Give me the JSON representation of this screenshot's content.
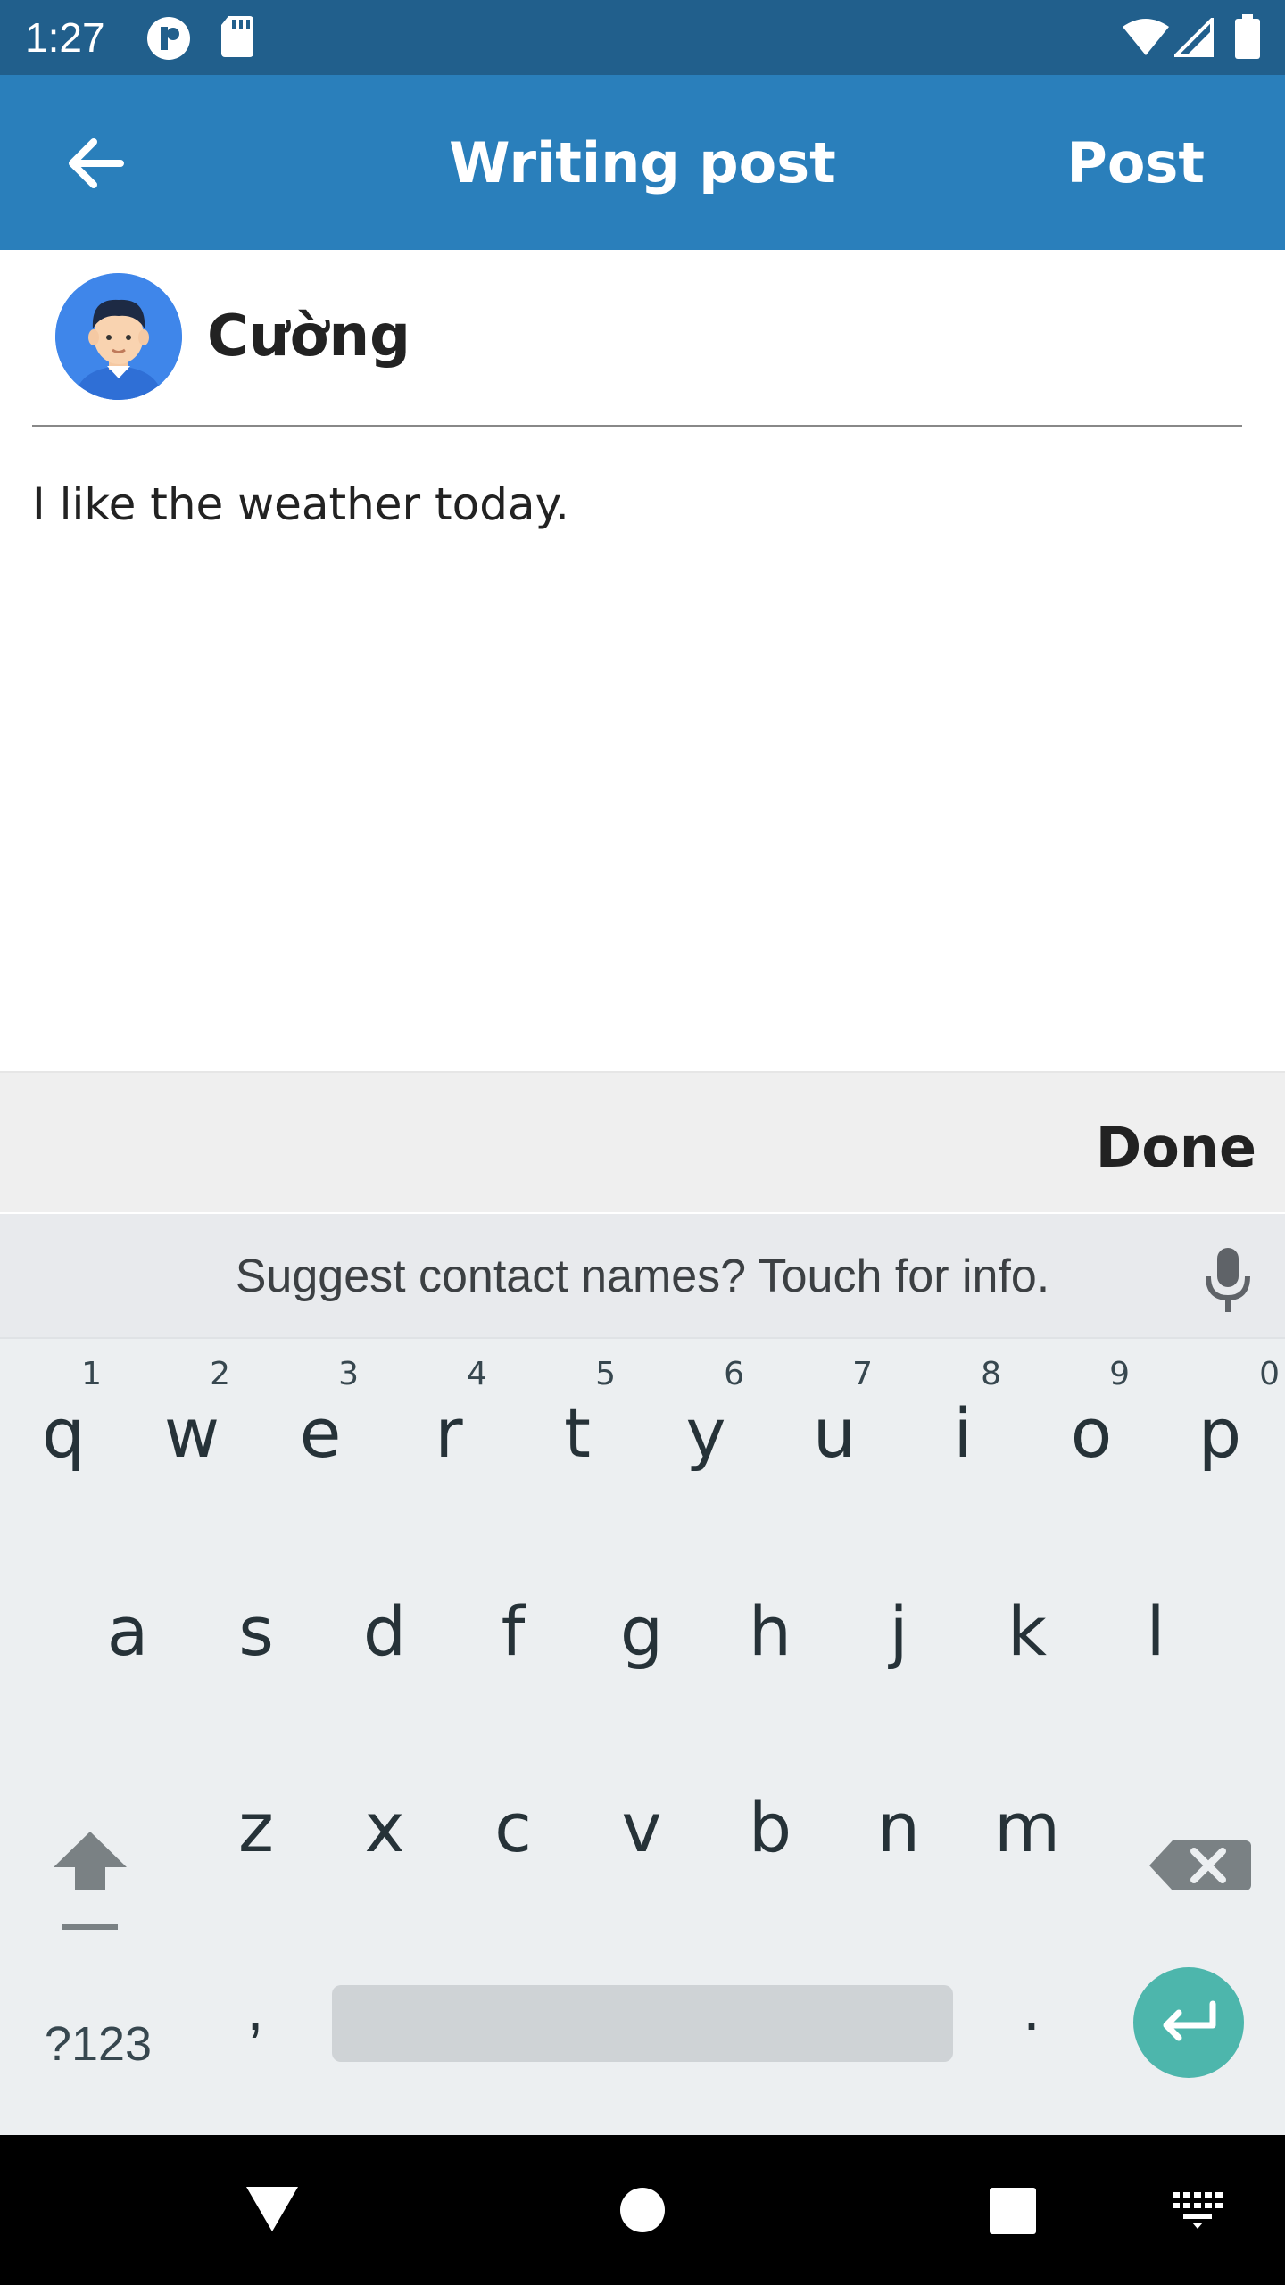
{
  "status_bar": {
    "time": "1:27",
    "icons": [
      "vpn-key-icon",
      "sd-card-icon",
      "wifi-icon",
      "cell-signal-icon",
      "battery-icon"
    ]
  },
  "app_bar": {
    "back_icon": "arrow-left-icon",
    "title": "Writing post",
    "post_label": "Post",
    "color": "#2a7fbb"
  },
  "user": {
    "avatar_icon": "user-avatar-icon",
    "name": "Cường"
  },
  "post": {
    "body": "I like the weather today."
  },
  "accessory": {
    "done_label": "Done"
  },
  "keyboard": {
    "suggestion": "Suggest contact names? Touch for info.",
    "row1": [
      {
        "key": "q",
        "hint": "1"
      },
      {
        "key": "w",
        "hint": "2"
      },
      {
        "key": "e",
        "hint": "3"
      },
      {
        "key": "r",
        "hint": "4"
      },
      {
        "key": "t",
        "hint": "5"
      },
      {
        "key": "y",
        "hint": "6"
      },
      {
        "key": "u",
        "hint": "7"
      },
      {
        "key": "i",
        "hint": "8"
      },
      {
        "key": "o",
        "hint": "9"
      },
      {
        "key": "p",
        "hint": "0"
      }
    ],
    "row2": [
      "a",
      "s",
      "d",
      "f",
      "g",
      "h",
      "j",
      "k",
      "l"
    ],
    "row3": [
      "z",
      "x",
      "c",
      "v",
      "b",
      "n",
      "m"
    ],
    "symbols_label": "?123",
    "comma": ",",
    "period": ".",
    "enter_color": "#4db6ac"
  },
  "nav_bar": {
    "icons": [
      "back-triangle-icon",
      "home-circle-icon",
      "recents-square-icon",
      "keyboard-switch-icon"
    ]
  }
}
